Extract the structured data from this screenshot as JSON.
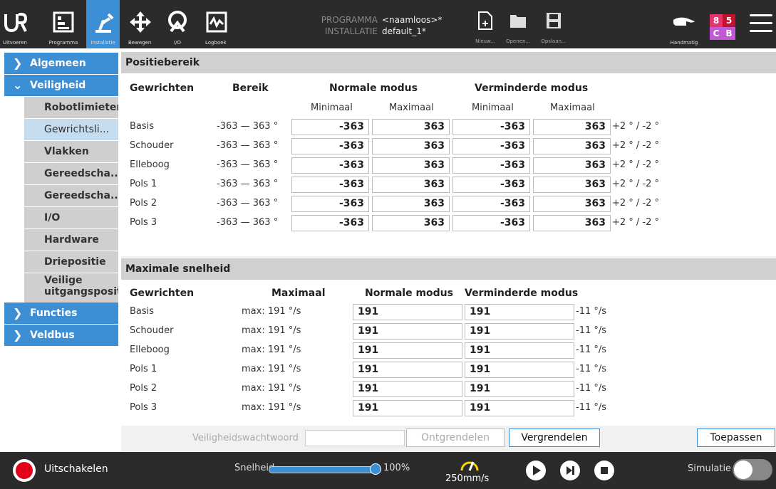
{
  "topbar": {
    "tabs": [
      {
        "label": "Uitvoeren",
        "icon": "ur-logo-icon"
      },
      {
        "label": "Programma",
        "icon": "program-icon"
      },
      {
        "label": "Installatie",
        "icon": "robot-arm-icon"
      },
      {
        "label": "Bewegen",
        "icon": "move-icon"
      },
      {
        "label": "I/O",
        "icon": "io-icon"
      },
      {
        "label": "Logboek",
        "icon": "log-icon"
      }
    ],
    "program_key": "PROGRAMMA",
    "program_value": "<naamloos>*",
    "install_key": "INSTALLATIE",
    "install_value": "default_1*",
    "file_buttons": [
      {
        "label": "Nieuw..."
      },
      {
        "label": "Openen..."
      },
      {
        "label": "Opslaan..."
      }
    ],
    "mode_label": "Handmatig",
    "status": [
      "8",
      "5",
      "C",
      "B"
    ]
  },
  "sidebar": {
    "top": [
      {
        "label": "Algemeen"
      },
      {
        "label": "Veiligheid"
      },
      {
        "label": "Functies"
      },
      {
        "label": "Veldbus"
      }
    ],
    "sub": [
      {
        "label": "Robotlimieten"
      },
      {
        "label": "Gewrichtsli..."
      },
      {
        "label": "Vlakken"
      },
      {
        "label": "Gereedscha..."
      },
      {
        "label": "Gereedscha..."
      },
      {
        "label": "I/O"
      },
      {
        "label": "Hardware"
      },
      {
        "label": "Driepositie"
      },
      {
        "label": "Veilige uitgangspositie"
      }
    ]
  },
  "position": {
    "title": "Positiebereik",
    "h_joints": "Gewrichten",
    "h_range": "Bereik",
    "h_normal": "Normale modus",
    "h_reduced": "Verminderde modus",
    "sub_min": "Minimaal",
    "sub_max": "Maximaal",
    "rows": [
      {
        "name": "Basis",
        "range": "-363 — 363 °",
        "nmin": "-363",
        "nmax": "363",
        "rmin": "-363",
        "rmax": "363",
        "tol": "+2 ° / -2 °"
      },
      {
        "name": "Schouder",
        "range": "-363 — 363 °",
        "nmin": "-363",
        "nmax": "363",
        "rmin": "-363",
        "rmax": "363",
        "tol": "+2 ° / -2 °"
      },
      {
        "name": "Elleboog",
        "range": "-363 — 363 °",
        "nmin": "-363",
        "nmax": "363",
        "rmin": "-363",
        "rmax": "363",
        "tol": "+2 ° / -2 °"
      },
      {
        "name": "Pols 1",
        "range": "-363 — 363 °",
        "nmin": "-363",
        "nmax": "363",
        "rmin": "-363",
        "rmax": "363",
        "tol": "+2 ° / -2 °"
      },
      {
        "name": "Pols 2",
        "range": "-363 — 363 °",
        "nmin": "-363",
        "nmax": "363",
        "rmin": "-363",
        "rmax": "363",
        "tol": "+2 ° / -2 °"
      },
      {
        "name": "Pols 3",
        "range": "-363 — 363 °",
        "nmin": "-363",
        "nmax": "363",
        "rmin": "-363",
        "rmax": "363",
        "tol": "+2 ° / -2 °"
      }
    ]
  },
  "speed": {
    "title": "Maximale snelheid",
    "h_joints": "Gewrichten",
    "h_max": "Maximaal",
    "h_normal": "Normale modus",
    "h_reduced": "Verminderde modus",
    "rows": [
      {
        "name": "Basis",
        "max": "max: 191 °/s",
        "normal": "191",
        "reduced": "191",
        "tol": "-11 °/s"
      },
      {
        "name": "Schouder",
        "max": "max: 191 °/s",
        "normal": "191",
        "reduced": "191",
        "tol": "-11 °/s"
      },
      {
        "name": "Elleboog",
        "max": "max: 191 °/s",
        "normal": "191",
        "reduced": "191",
        "tol": "-11 °/s"
      },
      {
        "name": "Pols 1",
        "max": "max: 191 °/s",
        "normal": "191",
        "reduced": "191",
        "tol": "-11 °/s"
      },
      {
        "name": "Pols 2",
        "max": "max: 191 °/s",
        "normal": "191",
        "reduced": "191",
        "tol": "-11 °/s"
      },
      {
        "name": "Pols 3",
        "max": "max: 191 °/s",
        "normal": "191",
        "reduced": "191",
        "tol": "-11 °/s"
      }
    ]
  },
  "actions": {
    "password_label": "Veiligheidswachtwoord",
    "unlock": "Ontgrendelen",
    "lock": "Vergrendelen",
    "apply": "Toepassen"
  },
  "bottombar": {
    "power_label": "Uitschakelen",
    "speed_label": "Snelheid",
    "speed_value": "100%",
    "speed_fraction": 1.0,
    "tcp_speed": "250mm/s",
    "sim_label": "Simulatie"
  }
}
